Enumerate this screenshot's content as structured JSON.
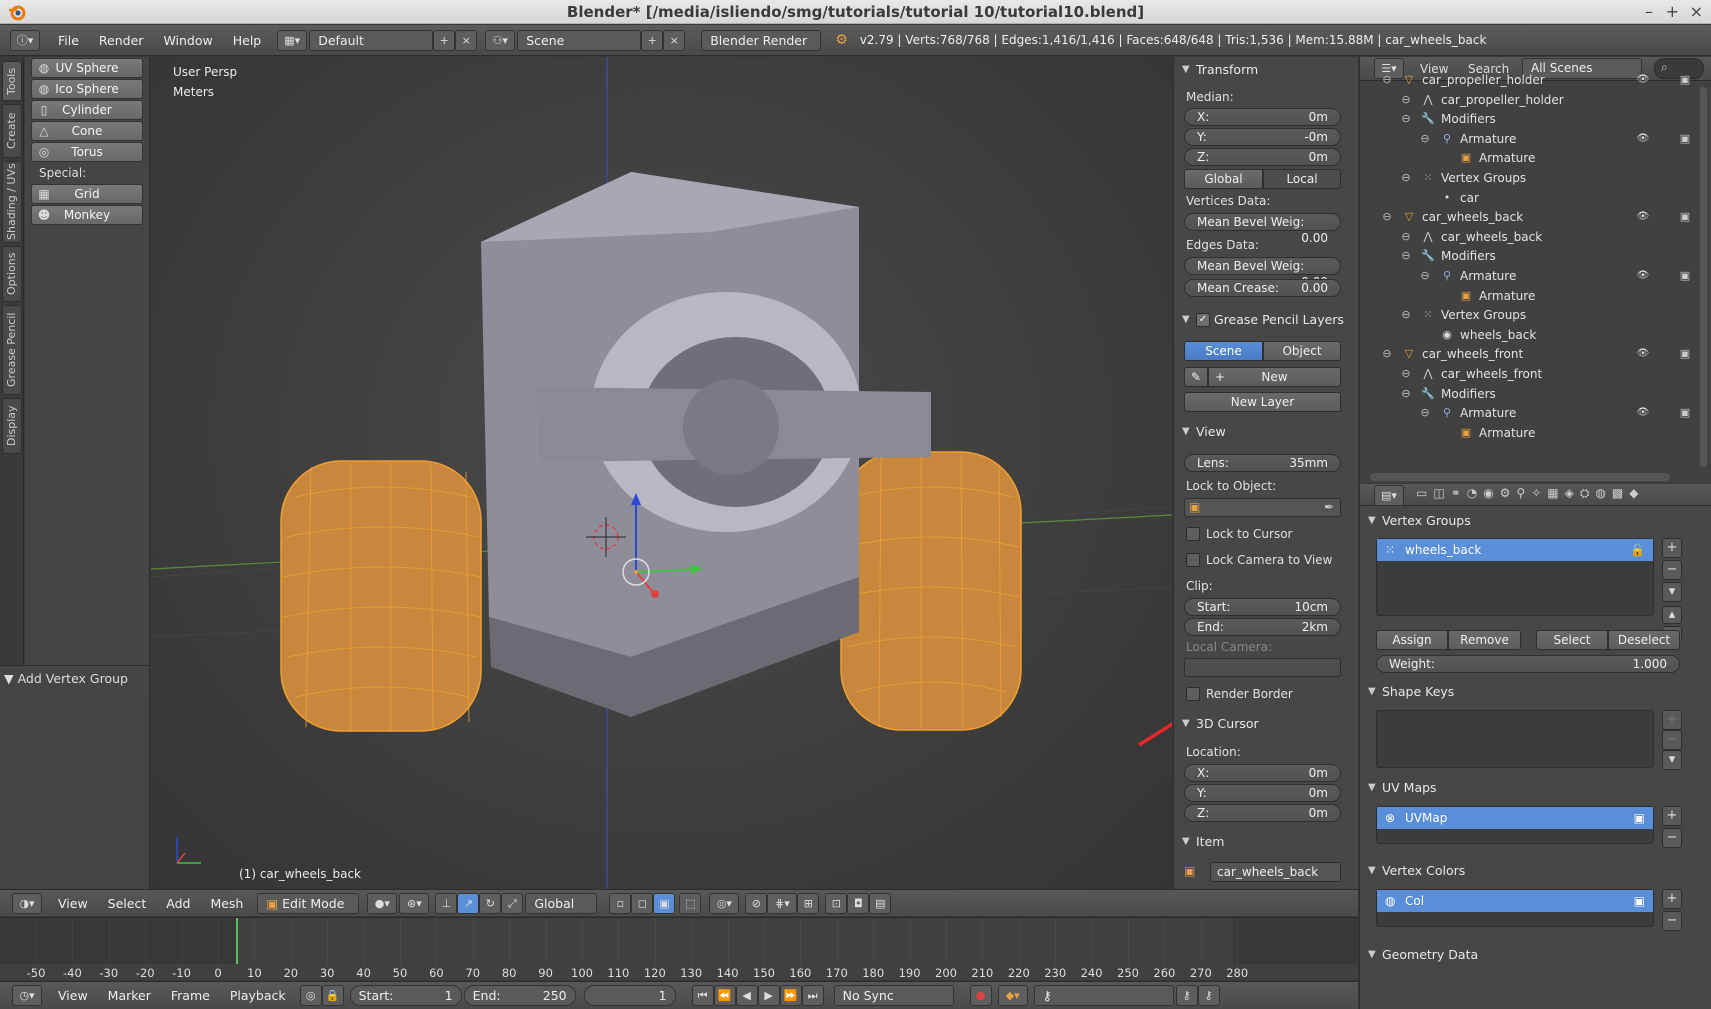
{
  "window": {
    "title": "Blender* [/media/isliendo/smg/tutorials/tutorial 10/tutorial10.blend]",
    "minimize": "–",
    "maximize": "+",
    "close": "×"
  },
  "info_header": {
    "menus": [
      "File",
      "Render",
      "Window",
      "Help"
    ],
    "screen_layout": "Default",
    "scene": "Scene",
    "render_engine": "Blender Render",
    "stats": "v2.79 | Verts:768/768 | Edges:1,416/1,416 | Faces:648/648 | Tris:1,536 | Mem:15.88M | car_wheels_back"
  },
  "tool_tabs": [
    "Tools",
    "Create",
    "Shading / UVs",
    "Options",
    "Grease Pencil",
    "Display"
  ],
  "tool_shelf": {
    "primitives": [
      {
        "label": "UV Sphere",
        "icon": "uv-sphere-icon"
      },
      {
        "label": "Ico Sphere",
        "icon": "ico-sphere-icon"
      },
      {
        "label": "Cylinder",
        "icon": "cylinder-icon"
      },
      {
        "label": "Cone",
        "icon": "cone-icon"
      },
      {
        "label": "Torus",
        "icon": "torus-icon"
      }
    ],
    "special_label": "Special:",
    "special": [
      {
        "label": "Grid",
        "icon": "grid-icon"
      },
      {
        "label": "Monkey",
        "icon": "monkey-icon"
      }
    ],
    "operator_panel": "Add Vertex Group"
  },
  "viewport": {
    "view_name": "User Persp",
    "units": "Meters",
    "object_label": "(1) car_wheels_back"
  },
  "npanel": {
    "transform": {
      "header": "Transform",
      "median_label": "Median:",
      "x": {
        "label": "X:",
        "value": "0m"
      },
      "y": {
        "label": "Y:",
        "value": "-0m"
      },
      "z": {
        "label": "Z:",
        "value": "0m"
      },
      "global": "Global",
      "local": "Local",
      "vertices_data": "Vertices Data:",
      "mean_bevel_weight_v": {
        "label": "Mean Bevel Weig:",
        "value": "0.00"
      },
      "edges_data": "Edges Data:",
      "mean_bevel_weight_e": {
        "label": "Mean Bevel Weig:",
        "value": "0.00"
      },
      "mean_crease": {
        "label": "Mean Crease:",
        "value": "0.00"
      }
    },
    "grease_pencil": {
      "header": "Grease Pencil Layers",
      "scene": "Scene",
      "object": "Object",
      "new": "New",
      "new_layer": "New Layer"
    },
    "view": {
      "header": "View",
      "lens": {
        "label": "Lens:",
        "value": "35mm"
      },
      "lock_to_object": "Lock to Object:",
      "lock_to_cursor": "Lock to Cursor",
      "lock_camera": "Lock Camera to View",
      "clip": "Clip:",
      "start": {
        "label": "Start:",
        "value": "10cm"
      },
      "end": {
        "label": "End:",
        "value": "2km"
      },
      "local_camera": "Local Camera:",
      "render_border": "Render Border"
    },
    "cursor": {
      "header": "3D Cursor",
      "location": "Location:",
      "x": {
        "label": "X:",
        "value": "0m"
      },
      "y": {
        "label": "Y:",
        "value": "0m"
      },
      "z": {
        "label": "Z:",
        "value": "0m"
      }
    },
    "item": {
      "header": "Item",
      "name": "car_wheels_back"
    }
  },
  "outliner": {
    "header_menus": [
      "View",
      "Search"
    ],
    "display_mode": "All Scenes",
    "rows": [
      {
        "label": "car_propeller_holder",
        "indent": 0,
        "icon": "object-icon",
        "eye": true
      },
      {
        "label": "car_propeller_holder",
        "indent": 1,
        "icon": "mesh-icon",
        "eye": false
      },
      {
        "label": "Modifiers",
        "indent": 1,
        "icon": "wrench-icon",
        "eye": false
      },
      {
        "label": "Armature",
        "indent": 2,
        "icon": "armature-mod-icon",
        "eye": true
      },
      {
        "label": "Armature",
        "indent": 3,
        "icon": "armature-data-icon",
        "eye": false
      },
      {
        "label": "Vertex Groups",
        "indent": 1,
        "icon": "vertex-groups-icon",
        "eye": false
      },
      {
        "label": "car",
        "indent": 2,
        "icon": "dot-icon",
        "eye": false
      },
      {
        "label": "car_wheels_back",
        "indent": 0,
        "icon": "object-icon",
        "eye": true,
        "selected": true
      },
      {
        "label": "car_wheels_back",
        "indent": 1,
        "icon": "mesh-icon",
        "eye": false
      },
      {
        "label": "Modifiers",
        "indent": 1,
        "icon": "wrench-icon",
        "eye": false
      },
      {
        "label": "Armature",
        "indent": 2,
        "icon": "armature-mod-icon",
        "eye": true
      },
      {
        "label": "Armature",
        "indent": 3,
        "icon": "armature-data-icon",
        "eye": false
      },
      {
        "label": "Vertex Groups",
        "indent": 1,
        "icon": "vertex-groups-icon",
        "eye": false
      },
      {
        "label": "wheels_back",
        "indent": 2,
        "icon": "vertex-group-icon",
        "eye": false
      },
      {
        "label": "car_wheels_front",
        "indent": 0,
        "icon": "object-icon",
        "eye": true
      },
      {
        "label": "car_wheels_front",
        "indent": 1,
        "icon": "mesh-icon",
        "eye": false
      },
      {
        "label": "Modifiers",
        "indent": 1,
        "icon": "wrench-icon",
        "eye": false
      },
      {
        "label": "Armature",
        "indent": 2,
        "icon": "armature-mod-icon",
        "eye": true
      },
      {
        "label": "Armature",
        "indent": 3,
        "icon": "armature-data-icon",
        "eye": false
      }
    ]
  },
  "properties": {
    "vertex_groups": {
      "header": "Vertex Groups",
      "items": [
        "wheels_back"
      ],
      "assign": "Assign",
      "remove": "Remove",
      "select": "Select",
      "deselect": "Deselect",
      "weight": {
        "label": "Weight:",
        "value": "1.000"
      }
    },
    "shape_keys": {
      "header": "Shape Keys"
    },
    "uv_maps": {
      "header": "UV Maps",
      "items": [
        "UVMap"
      ]
    },
    "vertex_colors": {
      "header": "Vertex Colors",
      "items": [
        "Col"
      ]
    },
    "geometry_data": {
      "header": "Geometry Data"
    }
  },
  "viewport_header": {
    "menus": [
      "View",
      "Select",
      "Add",
      "Mesh"
    ],
    "mode": "Edit Mode",
    "orientation": "Global"
  },
  "timeline": {
    "ticks": [
      "-50",
      "-40",
      "-30",
      "-20",
      "-10",
      "0",
      "10",
      "20",
      "30",
      "40",
      "50",
      "60",
      "70",
      "80",
      "90",
      "100",
      "110",
      "120",
      "130",
      "140",
      "150",
      "160",
      "170",
      "180",
      "190",
      "200",
      "210",
      "220",
      "230",
      "240",
      "250",
      "260",
      "270",
      "280"
    ],
    "menus": [
      "View",
      "Marker",
      "Frame",
      "Playback"
    ],
    "start": {
      "label": "Start:",
      "value": "1"
    },
    "end": {
      "label": "End:",
      "value": "250"
    },
    "current": "1",
    "sync": "No Sync"
  },
  "colors": {
    "accent": "#5a8ed8",
    "selection_orange": "#f0a030",
    "annotation_arrow": "#e8262a"
  }
}
